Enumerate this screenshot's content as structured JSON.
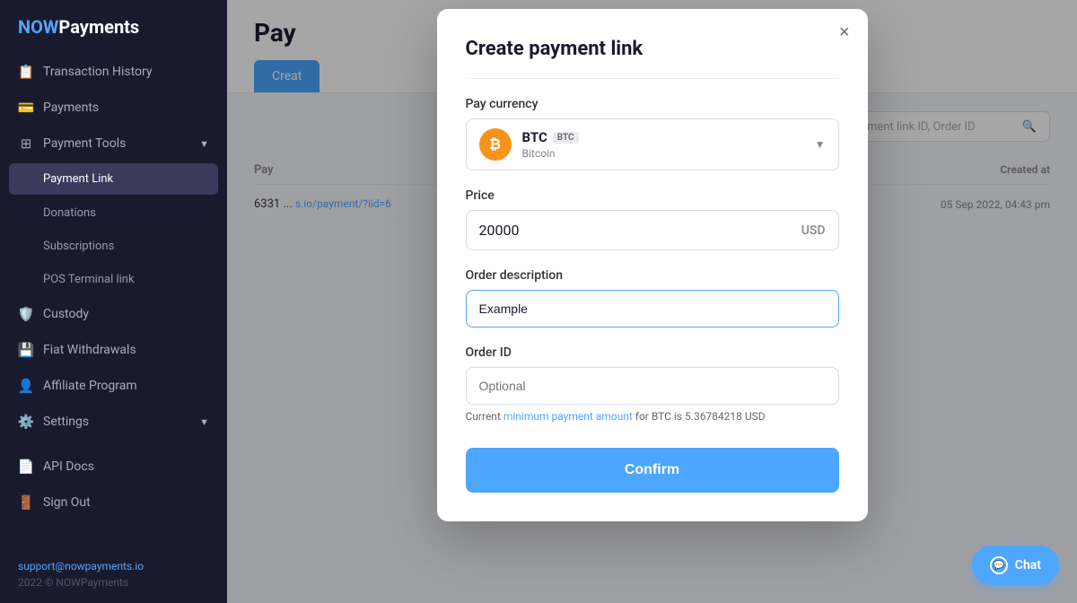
{
  "brand": {
    "now": "NOW",
    "payments": "Payments"
  },
  "sidebar": {
    "items": [
      {
        "id": "transaction-history",
        "label": "Transaction History",
        "icon": "📋",
        "active": false
      },
      {
        "id": "payments",
        "label": "Payments",
        "icon": "💳",
        "active": false
      },
      {
        "id": "payment-tools",
        "label": "Payment Tools",
        "icon": "⊞",
        "active": true,
        "hasArrow": true
      },
      {
        "id": "payment-link",
        "label": "Payment Link",
        "active": true,
        "sub": true
      },
      {
        "id": "donations",
        "label": "Donations",
        "active": false,
        "sub": true
      },
      {
        "id": "subscriptions",
        "label": "Subscriptions",
        "active": false,
        "sub": true
      },
      {
        "id": "pos-terminal",
        "label": "POS Terminal link",
        "active": false,
        "sub": true
      },
      {
        "id": "custody",
        "label": "Custody",
        "icon": "🛡️",
        "active": false
      },
      {
        "id": "fiat-withdrawals",
        "label": "Fiat Withdrawals",
        "icon": "💾",
        "active": false
      },
      {
        "id": "affiliate-program",
        "label": "Affiliate Program",
        "icon": "👤",
        "active": false
      },
      {
        "id": "settings",
        "label": "Settings",
        "icon": "⚙️",
        "active": false,
        "hasArrow": true
      }
    ],
    "bottom_items": [
      {
        "id": "api-docs",
        "label": "API Docs",
        "icon": "📄"
      },
      {
        "id": "sign-out",
        "label": "Sign Out",
        "icon": "🚪"
      }
    ],
    "support_email": "support@nowpayments.io",
    "copyright": "2022 © NOWPayments"
  },
  "main": {
    "title": "Pay",
    "tabs": [
      {
        "id": "create",
        "label": "Creat",
        "active": true
      }
    ],
    "search_placeholder": "Payment link ID, Order ID",
    "table": {
      "columns": [
        "Pay",
        "Created at"
      ],
      "rows": [
        {
          "id": "6331",
          "link": "s.io/payment/?iid=6",
          "created": "05 Sep 2022, 04:43 pm"
        }
      ]
    }
  },
  "modal": {
    "title": "Create payment link",
    "close_label": "×",
    "pay_currency_label": "Pay currency",
    "currency": {
      "symbol": "BTC",
      "badge": "BTC",
      "full_name": "Bitcoin",
      "icon": "₿"
    },
    "price_label": "Price",
    "price_value": "20000",
    "price_currency": "USD",
    "order_description_label": "Order description",
    "order_description_value": "Example",
    "order_id_label": "Order ID",
    "order_id_placeholder": "Optional",
    "hint_prefix": "Current ",
    "hint_link_text": "minimum payment amount",
    "hint_suffix": " for BTC is 5.36784218 USD",
    "confirm_label": "Confirm"
  },
  "chat": {
    "label": "Chat",
    "icon": "💬"
  }
}
